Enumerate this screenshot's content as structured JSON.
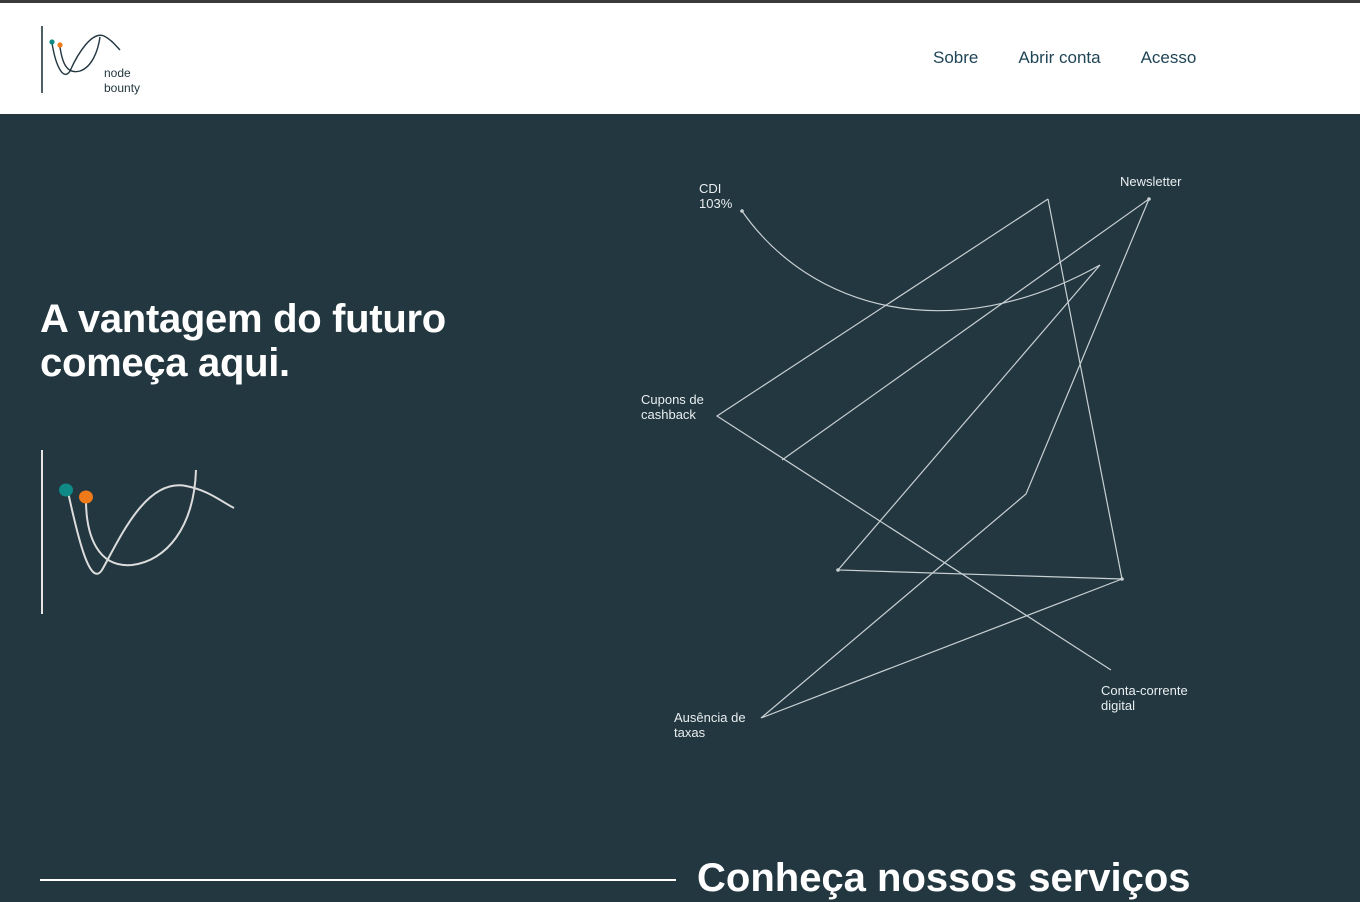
{
  "brand": {
    "line1": "node",
    "line2": "bounty",
    "colors": {
      "teal": "#0f8a86",
      "orange": "#f07a1a",
      "navy": "#233740"
    }
  },
  "nav": {
    "items": [
      "Sobre",
      "Abrir conta",
      "Acesso"
    ]
  },
  "hero": {
    "title_line1": "A vantagem do futuro",
    "title_line2": "começa aqui.",
    "background": "#233740"
  },
  "diagram": {
    "labels": {
      "cdi_line1": "CDI",
      "cdi_line2": "103%",
      "newsletter": "Newsletter",
      "cupons_line1": "Cupons de",
      "cupons_line2": "cashback",
      "conta_line1": "Conta-corrente",
      "conta_line2": "digital",
      "ausencia_line1": "Ausência de",
      "ausencia_line2": "taxas"
    }
  },
  "services": {
    "title": "Conheça nossos serviços"
  }
}
